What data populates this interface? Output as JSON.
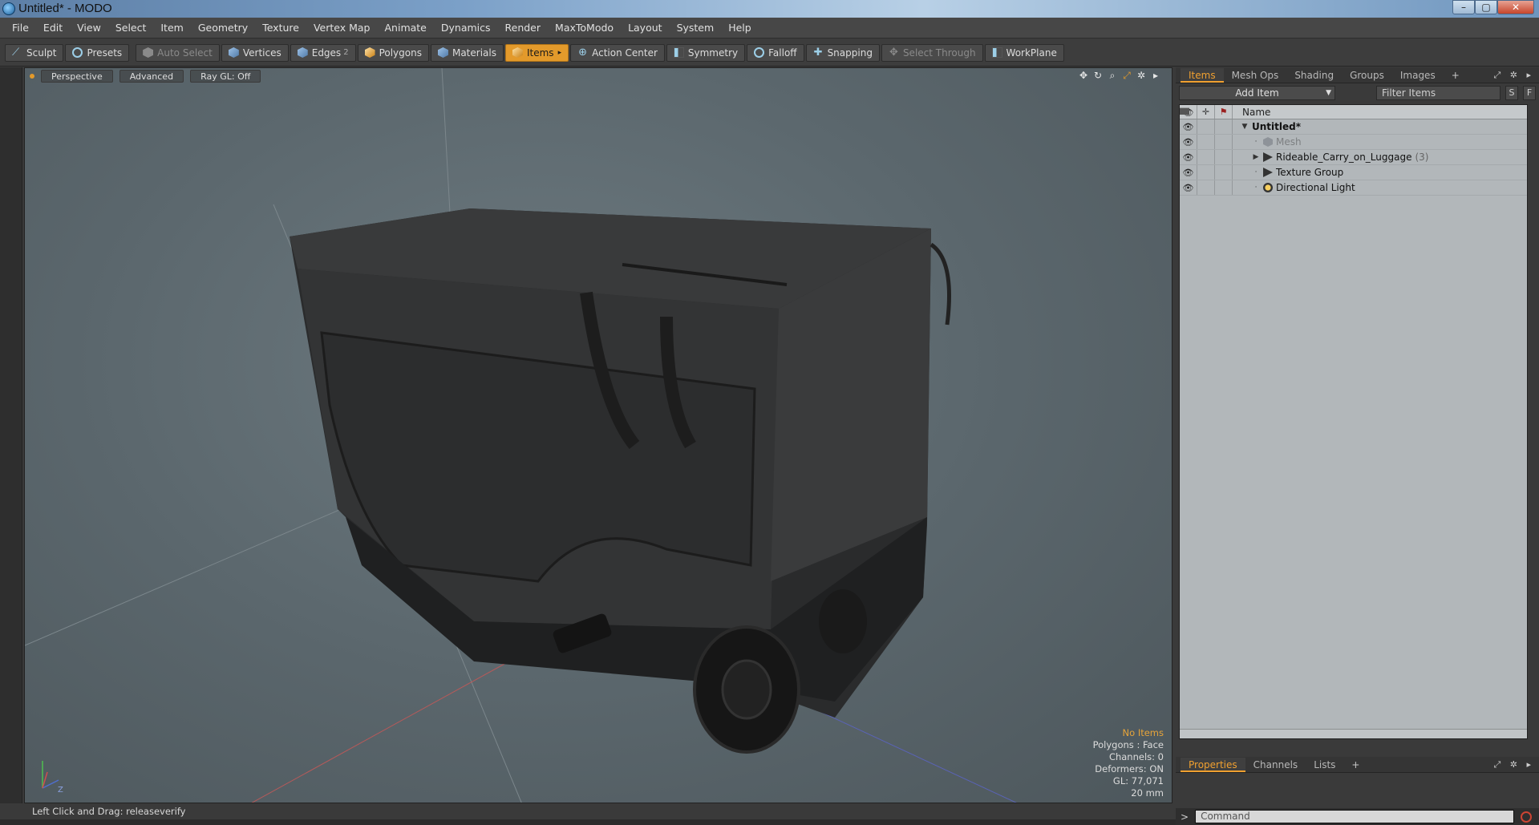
{
  "window": {
    "title": "Untitled* - MODO",
    "minimize": "–",
    "maximize": "▢",
    "close": "✕"
  },
  "menu": [
    "File",
    "Edit",
    "View",
    "Select",
    "Item",
    "Geometry",
    "Texture",
    "Vertex Map",
    "Animate",
    "Dynamics",
    "Render",
    "MaxToModo",
    "Layout",
    "System",
    "Help"
  ],
  "toolbar": {
    "sculpt": "Sculpt",
    "presets": "Presets",
    "auto_select": "Auto Select",
    "vertices": "Vertices",
    "edges": "Edges",
    "edges_count": "2",
    "polygons": "Polygons",
    "materials": "Materials",
    "items": "Items",
    "action_center": "Action Center",
    "symmetry": "Symmetry",
    "falloff": "Falloff",
    "snapping": "Snapping",
    "select_through": "Select Through",
    "workplane": "WorkPlane"
  },
  "viewport": {
    "tabs": [
      "Perspective",
      "Advanced",
      "Ray GL: Off"
    ],
    "info": {
      "selection": "No Items",
      "polygons": "Polygons : Face",
      "channels": "Channels: 0",
      "deformers": "Deformers: ON",
      "gl": "GL: 77,071",
      "scale": "20 mm"
    },
    "axis_label": "Z"
  },
  "status": {
    "hint": "Left Click and Drag:  releaseverify"
  },
  "items_panel": {
    "tabs": [
      "Items",
      "Mesh Ops",
      "Shading",
      "Groups",
      "Images",
      "+"
    ],
    "add_item": "Add Item",
    "filter_placeholder": "Filter Items",
    "s_button": "S",
    "f_button": "F",
    "column_name": "Name",
    "tree": [
      {
        "name": "Untitled*",
        "type": "scene"
      },
      {
        "name": "Mesh",
        "type": "mesh"
      },
      {
        "name": "Rideable_Carry_on_Luggage",
        "type": "group",
        "count": "(3)"
      },
      {
        "name": "Texture Group",
        "type": "group"
      },
      {
        "name": "Directional Light",
        "type": "light"
      }
    ]
  },
  "properties_panel": {
    "tabs": [
      "Properties",
      "Channels",
      "Lists",
      "+"
    ]
  },
  "command": {
    "prompt": ">",
    "placeholder": "Command"
  },
  "colors": {
    "accent": "#e39a2b",
    "viewport_bg": "#5b676d",
    "tree_bg": "#b2b7ba"
  }
}
